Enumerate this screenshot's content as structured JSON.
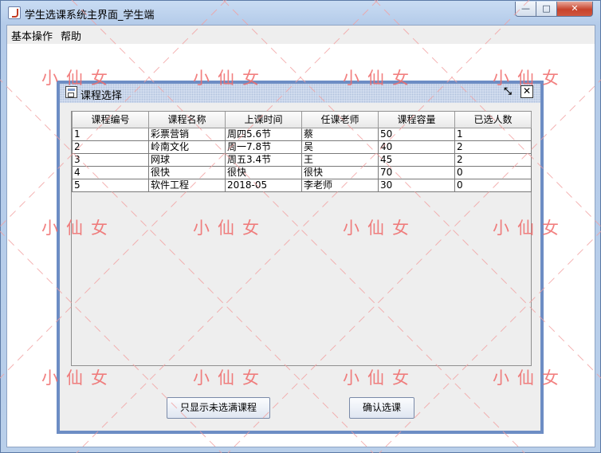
{
  "window": {
    "title": "学生选课系统主界面_学生端",
    "minimize_glyph": "—",
    "maximize_glyph": "□",
    "close_glyph": "✕"
  },
  "menubar": {
    "items": [
      "基本操作",
      "帮助"
    ]
  },
  "internal_frame": {
    "title": "课程选择",
    "iconify_glyph": "⤡",
    "close_glyph": "☒"
  },
  "table": {
    "columns": [
      "课程编号",
      "课程名称",
      "上课时间",
      "任课老师",
      "课程容量",
      "已选人数"
    ],
    "rows": [
      [
        "1",
        "彩票营销",
        "周四5.6节",
        "蔡",
        "50",
        "1"
      ],
      [
        "2",
        "岭南文化",
        "周一7.8节",
        "吴",
        "40",
        "2"
      ],
      [
        "3",
        "网球",
        "周五3.4节",
        "王",
        "45",
        "2"
      ],
      [
        "4",
        "很快",
        "很快",
        "很快",
        "70",
        "0"
      ],
      [
        "5",
        "软件工程",
        "2018-05",
        "李老师",
        "30",
        "0"
      ]
    ]
  },
  "buttons": {
    "filter_label": "只显示未选满课程",
    "confirm_label": "确认选课"
  },
  "watermark": {
    "text": "小仙女",
    "color": "#f06a6a"
  }
}
